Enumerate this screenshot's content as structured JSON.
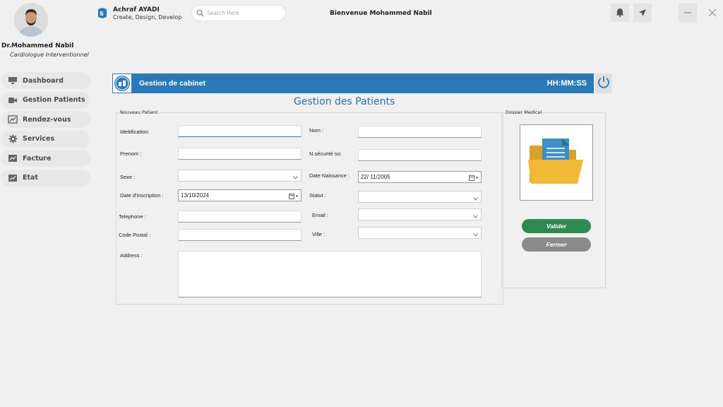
{
  "profile": {
    "name": "Dr.Mohammed Nabil",
    "specialty": "Cardiologue Interventionnel"
  },
  "nav": {
    "items": [
      {
        "label": "Dashboard",
        "icon": "monitor-icon"
      },
      {
        "label": "Gestion Patients",
        "icon": "video-icon"
      },
      {
        "label": "Rendez-vous",
        "icon": "chart-icon"
      },
      {
        "label": "Services",
        "icon": "gear-icon"
      },
      {
        "label": "Facture",
        "icon": "invoice-icon"
      },
      {
        "label": "Etat",
        "icon": "report-icon"
      }
    ]
  },
  "topbar": {
    "brand_name": "Achraf AYADI",
    "brand_tagline": "Create, Design, Develop",
    "search_placeholder": "Search Here",
    "welcome": "Bienvenue Mohammed Nabil"
  },
  "module": {
    "title": "Gestion de cabinet",
    "clock": "HH:MM:SS"
  },
  "page_title": "Gestion des Patients",
  "form": {
    "caption": "Nouveau Patient",
    "labels": {
      "identification": "Ideitification:",
      "nom": "Nom :",
      "prenom": "Prenom :",
      "nsecurite": "N.sécurité so:",
      "sexe": "Sexe :",
      "date_naissance": "Date Naissance :",
      "date_inscription": "Date d'inscription :",
      "statut": "Statut :",
      "telephone": "Telephone :",
      "email": "Email :",
      "code_postal": "Code Postal :",
      "ville": "Ville :",
      "address": "Address :"
    },
    "values": {
      "identification": "",
      "nom": "",
      "prenom": "",
      "nsecurite": "",
      "sexe": "",
      "date_naissance": "22/ 11/2005",
      "date_inscription": "13/10/2024",
      "statut": "",
      "telephone": "",
      "email": "",
      "code_postal": "",
      "ville": "",
      "address": ""
    }
  },
  "dossier": {
    "caption": "Dossier Medical",
    "valider_label": "Valider",
    "fermer_label": "Fermer"
  },
  "colors": {
    "accent": "#2a7ab8",
    "valider": "#2f8a4f",
    "fermer": "#8a8a8a"
  }
}
